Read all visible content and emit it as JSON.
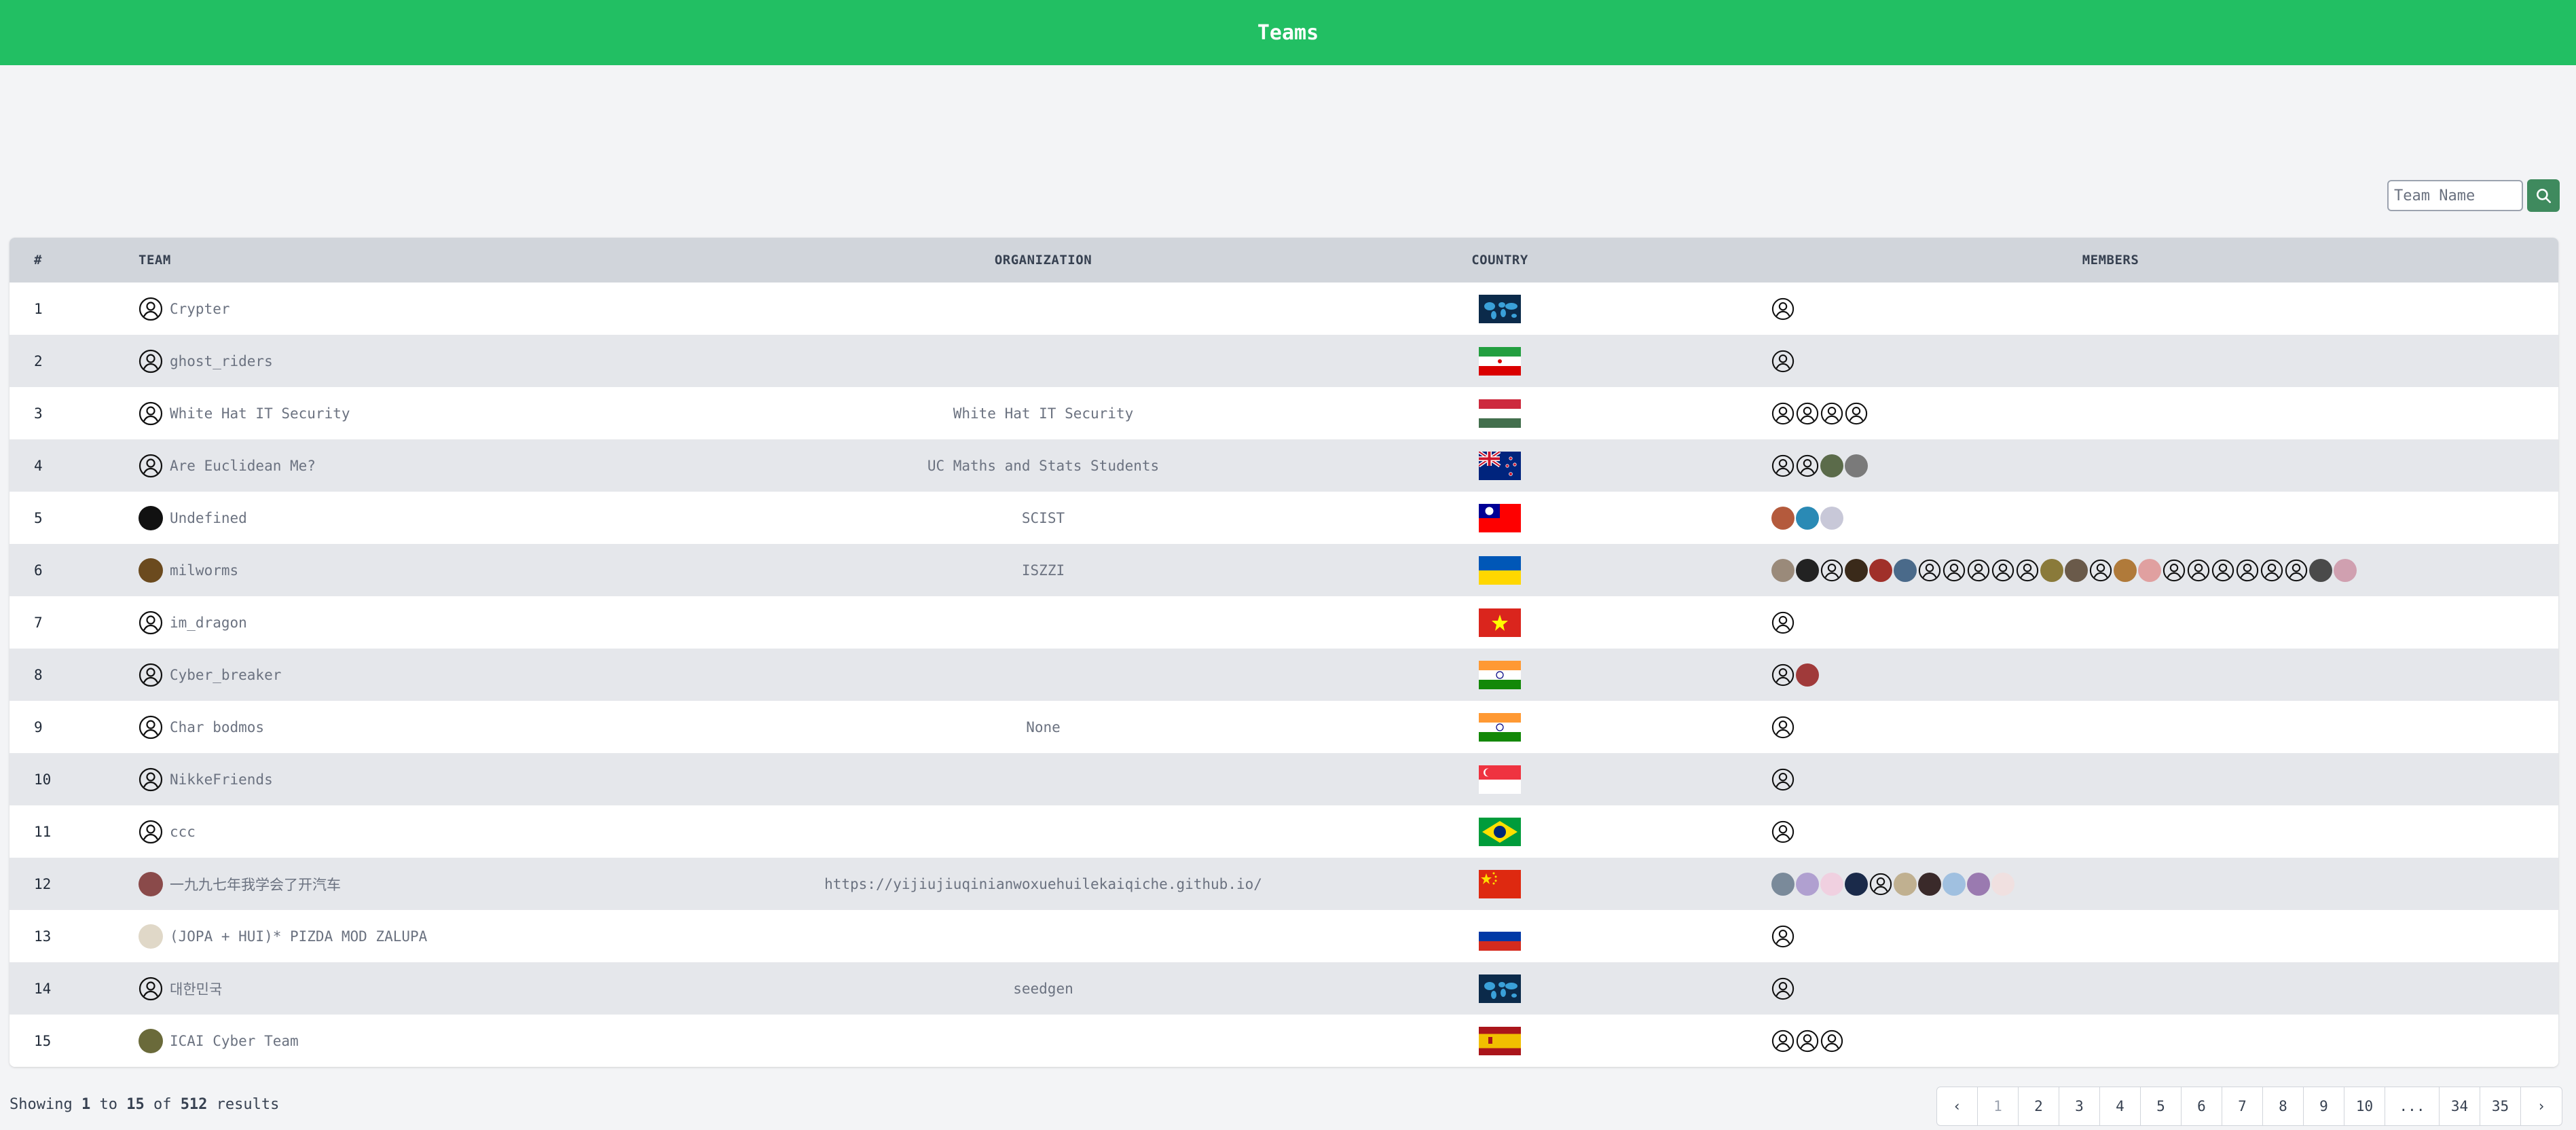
{
  "header": {
    "title": "Teams"
  },
  "search": {
    "placeholder": "Team Name"
  },
  "table": {
    "columns": [
      "#",
      "TEAM",
      "ORGANIZATION",
      "COUNTRY",
      "MEMBERS"
    ],
    "rows": [
      {
        "rank": "1",
        "team": "Crypter",
        "organization": "",
        "country": "world",
        "avatar": "default",
        "members": [
          "d"
        ]
      },
      {
        "rank": "2",
        "team": "ghost_riders",
        "organization": "",
        "country": "iran",
        "avatar": "default",
        "members": [
          "d"
        ]
      },
      {
        "rank": "3",
        "team": "White Hat IT Security",
        "organization": "White Hat IT Security",
        "country": "hungary",
        "avatar": "default",
        "members": [
          "d",
          "d",
          "d",
          "d"
        ]
      },
      {
        "rank": "4",
        "team": "Are Euclidean Me?",
        "organization": "UC Maths and Stats Students",
        "country": "newzealand",
        "avatar": "default",
        "members": [
          "d",
          "d",
          "#5b6b4a",
          "#7a7a7a"
        ]
      },
      {
        "rank": "5",
        "team": "Undefined",
        "organization": "SCIST",
        "country": "taiwan",
        "avatar": "#111111",
        "members": [
          "#b45a3c",
          "#2a8ab5",
          "#c8c8d8"
        ]
      },
      {
        "rank": "6",
        "team": "milworms",
        "organization": "ISZZI",
        "country": "ukraine",
        "avatar": "#6b4a1e",
        "members": [
          "#9a8a7a",
          "#222222",
          "d",
          "#3a2a1a",
          "#a0302a",
          "#4a6a8a",
          "d",
          "d",
          "d",
          "d",
          "d",
          "#8a7a3a",
          "#6a5a4a",
          "d",
          "#b07a3a",
          "#e0a0a0",
          "d",
          "d",
          "d",
          "d",
          "d",
          "d",
          "#4a4a4a",
          "#d0a0b0"
        ]
      },
      {
        "rank": "7",
        "team": "im_dragon",
        "organization": "",
        "country": "vietnam",
        "avatar": "default",
        "members": [
          "d"
        ]
      },
      {
        "rank": "8",
        "team": "Cyber_breaker",
        "organization": "",
        "country": "india",
        "avatar": "default",
        "members": [
          "d",
          "#a03a3a"
        ]
      },
      {
        "rank": "9",
        "team": "Char bodmos",
        "organization": "None",
        "country": "india",
        "avatar": "default",
        "members": [
          "d"
        ]
      },
      {
        "rank": "10",
        "team": "NikkeFriends",
        "organization": "",
        "country": "singapore",
        "avatar": "default",
        "members": [
          "d"
        ]
      },
      {
        "rank": "11",
        "team": "ccc",
        "organization": "",
        "country": "brazil",
        "avatar": "default",
        "members": [
          "d"
        ]
      },
      {
        "rank": "12",
        "team": "一九九七年我学会了开汽车",
        "organization": "https://yijiujiuqinianwoxuehuilekaiqiche.github.io/",
        "country": "china",
        "avatar": "#8a4a4a",
        "members": [
          "#7a8a9a",
          "#b0a0d0",
          "#f0d0e0",
          "#1a2a4a",
          "d",
          "#c0b090",
          "#3a2a2a",
          "#a0c0e0",
          "#9a7ab0",
          "#f0e0e0"
        ]
      },
      {
        "rank": "13",
        "team": "(JOPA + HUI)* PIZDA MOD ZALUPA",
        "organization": "",
        "country": "russia",
        "avatar": "#e0d8c8",
        "members": [
          "d"
        ]
      },
      {
        "rank": "14",
        "team": "대한민국",
        "organization": "seedgen",
        "country": "world",
        "avatar": "default",
        "members": [
          "d"
        ]
      },
      {
        "rank": "15",
        "team": "ICAI Cyber Team",
        "organization": "",
        "country": "spain",
        "avatar": "#6a6a3a",
        "members": [
          "d",
          "d",
          "d"
        ]
      }
    ]
  },
  "footer": {
    "prefix": "Showing ",
    "from": "1",
    "to_word": " to ",
    "to": "15",
    "of_word": " of ",
    "total": "512",
    "suffix": " results"
  },
  "pagination": {
    "prev": "‹",
    "pages": [
      "1",
      "2",
      "3",
      "4",
      "5",
      "6",
      "7",
      "8",
      "9",
      "10",
      "...",
      "34",
      "35"
    ],
    "next": "›",
    "current": "1"
  },
  "colors": {
    "header_bg": "#22bf63",
    "search_button": "#3f8a5e"
  }
}
